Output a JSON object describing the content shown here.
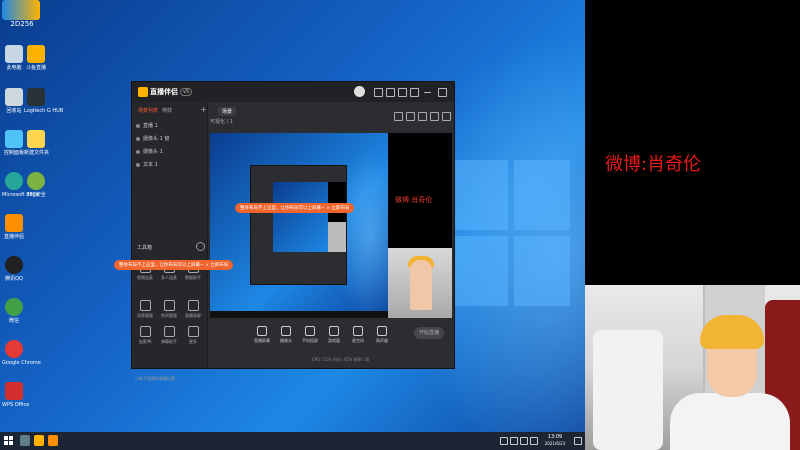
{
  "desktop": {
    "top_logo_number": "2D256",
    "icons": [
      {
        "label": "此电脑",
        "color": "#c8d6e5"
      },
      {
        "label": "斗鱼直播",
        "color": "#ffb300"
      },
      {
        "label": "回收站",
        "color": "#cfd8dc"
      },
      {
        "label": "Logitech G HUB",
        "color": "#263238"
      },
      {
        "label": "控制面板",
        "color": "#4fc3f7"
      },
      {
        "label": "新建文件夹",
        "color": "#ffd54f"
      },
      {
        "label": "Microsoft Edge",
        "color": "#26a69a"
      },
      {
        "label": "360安全",
        "color": "#7cb342"
      },
      {
        "label": "直播伴侣",
        "color": "#ff8f00"
      },
      {
        "label": "腾讯QQ",
        "color": "#212121"
      },
      {
        "label": "微信",
        "color": "#43a047"
      },
      {
        "label": "Google Chrome",
        "color": "#e53935"
      },
      {
        "label": "WPS Office",
        "color": "#d32f2f"
      }
    ]
  },
  "app": {
    "name": "直播伴侣",
    "version": "v5",
    "sidebar_tabs": [
      "场景列表",
      "特效"
    ],
    "plus": "+",
    "sources": [
      "直播 1",
      "摄像头 1 窗",
      "摄像头 1",
      "文本 1"
    ],
    "tools_title": "工具箱",
    "tools": [
      {
        "label": "视频连麦"
      },
      {
        "label": "多人连麦"
      },
      {
        "label": "数据助手"
      },
      {
        "label": "消息管理"
      },
      {
        "label": "房间管理"
      },
      {
        "label": "直播录屏"
      },
      {
        "label": "连麦PK"
      },
      {
        "label": "弹幕助手"
      },
      {
        "label": "更多"
      }
    ],
    "sidebar_footer": "小助手直播间弹幕设置",
    "scene_tab": "场景",
    "scene_toolbar": "可视化 / 1",
    "preview_weibo": "微博:肖奇伦",
    "toasts": [
      "整体布局不上这里，让你布局可以上屏幕~  ×  立即布局",
      "整体布局不上这里，让你布局可以上屏幕~  ×  立即布局"
    ],
    "bottom_buttons": [
      "直播屏幕",
      "摄像头",
      "手机投屏",
      "游戏窗",
      "麦克风",
      "扬声器"
    ],
    "start_live": "开始直播",
    "status": "CPU: 15%  内存: 45%  帧率: 30"
  },
  "taskbar": {
    "time": "13:09",
    "date": "2021/6/23"
  },
  "overlay": {
    "weibo": "微博:肖奇伦"
  },
  "colors": {
    "accent": "#f0642d",
    "weibo_red": "#e51b1b"
  }
}
